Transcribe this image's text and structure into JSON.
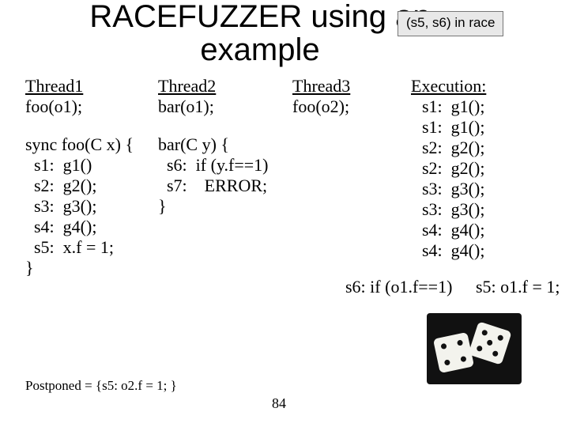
{
  "title_line1": "RACEFUZZER using an",
  "title_line2": "example",
  "badge": "(s5, s6) in race",
  "thread1": {
    "header": "Thread1",
    "call": "foo(o1);"
  },
  "thread2": {
    "header": "Thread2",
    "call": "bar(o1);"
  },
  "thread3": {
    "header": "Thread3",
    "call": "foo(o2);"
  },
  "foo_code": "sync foo(C x) {\n  s1:  g1()\n  s2:  g2();\n  s3:  g3();\n  s4:  g4();\n  s5:  x.f = 1;\n}",
  "bar_code": "bar(C y) {\n  s6:  if (y.f==1)\n  s7:    ERROR;\n}",
  "execution": {
    "header": "Execution:",
    "trace": "s1:  g1();\ns1:  g1();\ns2:  g2();\ns2:  g2();\ns3:  g3();\ns3:  g3();\ns4:  g4();\ns4:  g4();"
  },
  "race": {
    "left": "s6:  if (o1.f==1)",
    "right": "s5:  o1.f = 1;"
  },
  "postponed": "Postponed = {s5:  o2.f = 1; }",
  "page": "84"
}
